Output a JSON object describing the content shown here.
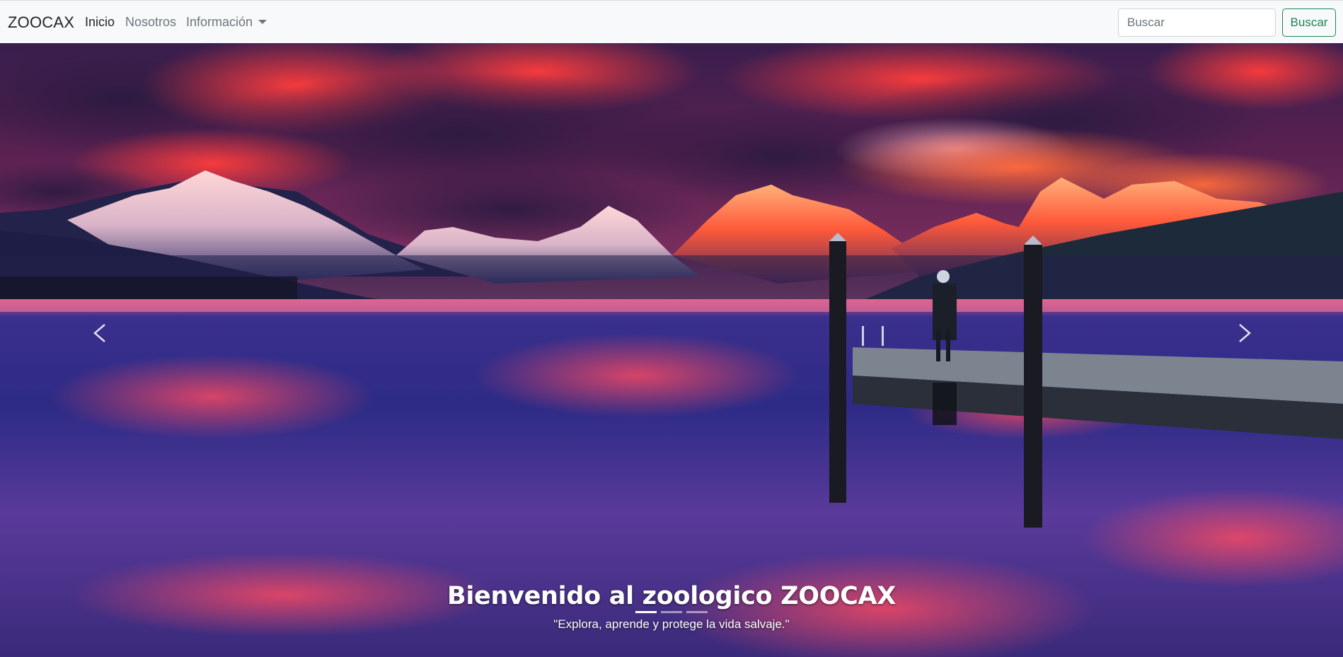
{
  "navbar": {
    "brand": "ZOOCAX",
    "links": [
      {
        "label": "Inicio",
        "active": true
      },
      {
        "label": "Nosotros",
        "active": false
      },
      {
        "label": "Información",
        "active": false,
        "dropdown": true
      }
    ],
    "search": {
      "placeholder": "Buscar",
      "value": "",
      "button_label": "Buscar"
    }
  },
  "carousel": {
    "image": "mountain-lake-sunset",
    "caption_title": "Bienvenido al zoologico ZOOCAX",
    "caption_text": "\"Explora, aprende y protege la vida salvaje.\"",
    "indicators": [
      {
        "active": true
      },
      {
        "active": false
      },
      {
        "active": false
      }
    ],
    "prev_icon": "chevron-left-icon",
    "next_icon": "chevron-right-icon"
  },
  "colors": {
    "navbar_bg": "#f8f9fa",
    "success": "#198754",
    "muted": "#6c757d",
    "text": "#212529"
  }
}
